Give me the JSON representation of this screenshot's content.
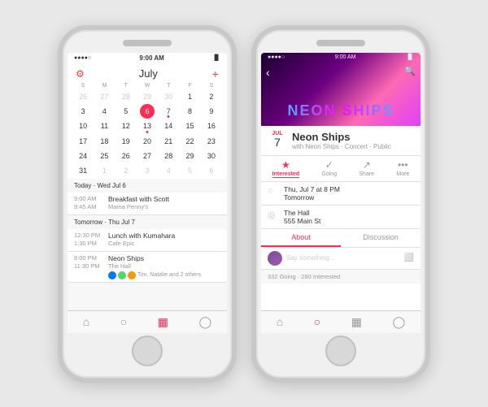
{
  "background_color": "#e8e8e8",
  "phone1": {
    "status_bar": {
      "signal": "●●●●○",
      "time": "9:00 AM",
      "battery": "🔋"
    },
    "calendar": {
      "month": "July",
      "days_of_week": [
        "S",
        "M",
        "T",
        "W",
        "T",
        "F",
        "S"
      ],
      "weeks": [
        [
          {
            "day": "26",
            "type": "prev"
          },
          {
            "day": "27",
            "type": "prev"
          },
          {
            "day": "28",
            "type": "prev"
          },
          {
            "day": "29",
            "type": "prev"
          },
          {
            "day": "30",
            "type": "prev"
          },
          {
            "day": "1",
            "type": "normal"
          },
          {
            "day": "2",
            "type": "normal"
          }
        ],
        [
          {
            "day": "3",
            "type": "normal"
          },
          {
            "day": "4",
            "type": "normal"
          },
          {
            "day": "5",
            "type": "normal"
          },
          {
            "day": "6",
            "type": "today"
          },
          {
            "day": "7",
            "type": "dot"
          },
          {
            "day": "8",
            "type": "normal"
          },
          {
            "day": "9",
            "type": "normal"
          }
        ],
        [
          {
            "day": "10",
            "type": "normal"
          },
          {
            "day": "11",
            "type": "normal"
          },
          {
            "day": "12",
            "type": "normal"
          },
          {
            "day": "13",
            "type": "dot"
          },
          {
            "day": "14",
            "type": "normal"
          },
          {
            "day": "15",
            "type": "normal"
          },
          {
            "day": "16",
            "type": "normal"
          }
        ],
        [
          {
            "day": "17",
            "type": "normal"
          },
          {
            "day": "18",
            "type": "normal"
          },
          {
            "day": "19",
            "type": "normal"
          },
          {
            "day": "20",
            "type": "normal"
          },
          {
            "day": "21",
            "type": "normal"
          },
          {
            "day": "22",
            "type": "normal"
          },
          {
            "day": "23",
            "type": "normal"
          }
        ],
        [
          {
            "day": "24",
            "type": "normal"
          },
          {
            "day": "25",
            "type": "normal"
          },
          {
            "day": "26",
            "type": "normal"
          },
          {
            "day": "27",
            "type": "normal"
          },
          {
            "day": "28",
            "type": "normal"
          },
          {
            "day": "29",
            "type": "normal"
          },
          {
            "day": "30",
            "type": "normal"
          }
        ],
        [
          {
            "day": "31",
            "type": "normal"
          },
          {
            "day": "1",
            "type": "next"
          },
          {
            "day": "2",
            "type": "next"
          },
          {
            "day": "3",
            "type": "next"
          },
          {
            "day": "4",
            "type": "next"
          },
          {
            "day": "5",
            "type": "next"
          },
          {
            "day": "6",
            "type": "next"
          }
        ]
      ],
      "today_section": "Today · Wed Jul 6",
      "tomorrow_section": "Tomorrow · Thu Jul 7",
      "events": [
        {
          "time": "9:00 AM",
          "end_time": "9:45 AM",
          "title": "Breakfast with Scott",
          "subtitle": "Mama Penny's",
          "has_avatars": false
        },
        {
          "time": "12:30 PM",
          "end_time": "1:30 PM",
          "title": "Lunch with Kumahara",
          "subtitle": "Cafe Epic",
          "has_avatars": false
        },
        {
          "time": "8:00 PM",
          "end_time": "11:30 PM",
          "title": "Neon Ships",
          "subtitle": "The Hall",
          "has_avatars": true,
          "friends_text": "Tim, Natalie and 2 others"
        }
      ]
    },
    "tab_bar": {
      "icons": [
        "⌂",
        "🔍",
        "📅",
        "👤"
      ]
    }
  },
  "phone2": {
    "status_bar": {
      "signal": "●●●●○",
      "time": "9:00 AM",
      "battery": "🔋"
    },
    "event": {
      "hero_text": "NEON SHIPS",
      "month": "JUL",
      "day": "7",
      "title": "Neon Ships",
      "subtitle": "with Neon Ships · Concert · Public",
      "actions": [
        {
          "icon": "★",
          "label": "Interested",
          "active": true
        },
        {
          "icon": "✓",
          "label": "Going",
          "active": false
        },
        {
          "icon": "↗",
          "label": "Share",
          "active": false
        },
        {
          "icon": "•••",
          "label": "More",
          "active": false
        }
      ],
      "details": [
        {
          "icon": "🕐",
          "text": "Thu, Jul 7 at 8 PM",
          "secondary": "Tomorrow"
        },
        {
          "icon": "📍",
          "text": "The Hall",
          "secondary": "555 Main St"
        }
      ],
      "tabs": [
        "About",
        "Discussion"
      ],
      "active_tab": "About",
      "comment_placeholder": "Say something...",
      "going_text": "332 Going · 280 Interested"
    },
    "tab_bar": {
      "icons": [
        "⌂",
        "🔍",
        "📅",
        "👤"
      ]
    }
  }
}
